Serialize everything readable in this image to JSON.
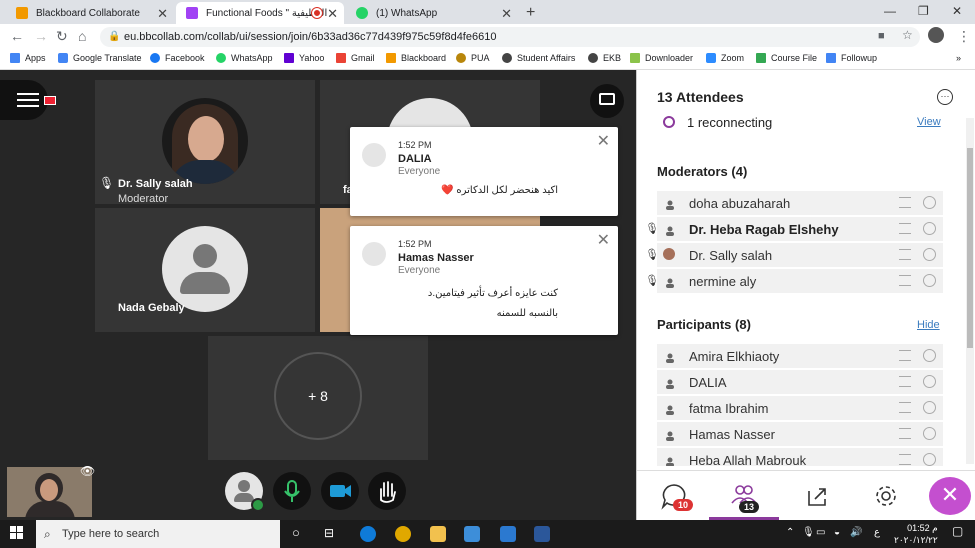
{
  "browser": {
    "tabs": [
      {
        "title": "Blackboard Collaborate",
        "fav_color": "#f29900"
      },
      {
        "title": "Functional Foods \" الوظيفية",
        "fav_color": "#a142f4"
      },
      {
        "title": "(1) WhatsApp",
        "fav_color": "#25d366"
      }
    ],
    "new_tab": "+",
    "url": "eu.bbcollab.com/collab/ui/session/join/6b33ad36c77d439f975c59f8d4fe6610",
    "bookmarks": [
      {
        "label": "Apps",
        "color": "#4285f4"
      },
      {
        "label": "Google Translate",
        "color": "#4285f4"
      },
      {
        "label": "Facebook",
        "color": "#1877f2"
      },
      {
        "label": "WhatsApp",
        "color": "#25d366"
      },
      {
        "label": "Yahoo",
        "color": "#6001d2"
      },
      {
        "label": "Gmail",
        "color": "#ea4335"
      },
      {
        "label": "Blackboard",
        "color": "#f29900"
      },
      {
        "label": "PUA",
        "color": "#b8860b"
      },
      {
        "label": "Student Affairs",
        "color": "#444444"
      },
      {
        "label": "EKB",
        "color": "#444444"
      },
      {
        "label": "Downloader",
        "color": "#8bc34a"
      },
      {
        "label": "Zoom",
        "color": "#2d8cff"
      },
      {
        "label": "Course File",
        "color": "#34a853"
      },
      {
        "label": "Followup",
        "color": "#4285f4"
      }
    ]
  },
  "stage": {
    "tiles": [
      {
        "name": "Dr. Sally salah",
        "role": "Moderator"
      },
      {
        "name": "fa"
      },
      {
        "name": "Nada Gebaly"
      }
    ],
    "overflow_count": "+ 8"
  },
  "notifications": [
    {
      "time": "1:52 PM",
      "sender": "DALIA",
      "audience": "Everyone",
      "message": "اكيد هنحضر لكل الدكاتره ❤️"
    },
    {
      "time": "1:52 PM",
      "sender": "Hamas Nasser",
      "audience": "Everyone",
      "message": "كنت عايزه أعرف تأثير فيتامين.د بالنسبه للسمنه"
    }
  ],
  "sidebar": {
    "title": "13 Attendees",
    "reconnecting": "1 reconnecting",
    "view_label": "View",
    "moderators_header": "Moderators (4)",
    "moderators": [
      {
        "name": "doha abuzaharah",
        "bold": false,
        "mic": false
      },
      {
        "name": "Dr. Heba Ragab Elshehy",
        "bold": true,
        "mic": true
      },
      {
        "name": "Dr. Sally salah",
        "bold": false,
        "mic": true
      },
      {
        "name": "nermine aly",
        "bold": false,
        "mic": true
      }
    ],
    "participants_header": "Participants (8)",
    "hide_label": "Hide",
    "participants": [
      {
        "name": "Amira Elkhiaoty"
      },
      {
        "name": "DALIA"
      },
      {
        "name": "fatma Ibrahim"
      },
      {
        "name": "Hamas Nasser"
      },
      {
        "name": "Heba Allah Mabrouk"
      }
    ],
    "chat_badge": "10",
    "attendees_badge": "13"
  },
  "taskbar": {
    "search_placeholder": "Type here to search",
    "lang": "ع",
    "time": "01:52 م",
    "date": "٢٠٢٠/١٢/٢٢"
  },
  "colors": {
    "accent": "#8b3a9c",
    "close_button": "#c44fcf",
    "link": "#3a7bbf"
  }
}
